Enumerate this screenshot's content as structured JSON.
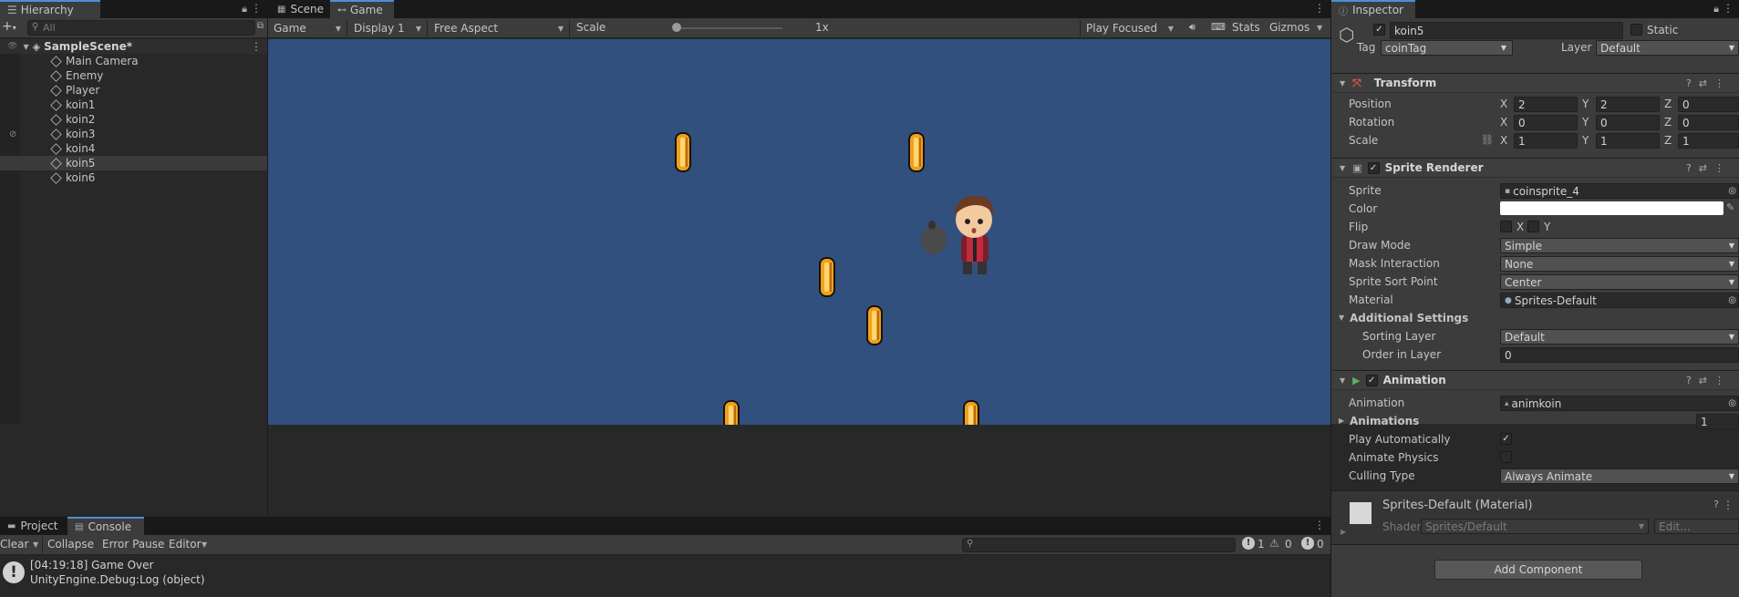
{
  "hierarchy": {
    "tab": "Hierarchy",
    "search_placeholder": "All",
    "scene": "SampleScene*",
    "items": [
      "Main Camera",
      "Enemy",
      "Player",
      "koin1",
      "koin2",
      "koin3",
      "koin4",
      "koin5",
      "koin6"
    ],
    "selected": "koin5"
  },
  "center_tabs": [
    "Scene",
    "Game"
  ],
  "game_toolbar": {
    "view": "Game",
    "display": "Display 1",
    "aspect": "Free Aspect",
    "scale_label": "Scale",
    "scale_value": "1x",
    "play_mode": "Play Focused",
    "stats": "Stats",
    "gizmos": "Gizmos"
  },
  "game_colors": {
    "background": "#31507e",
    "coin": "#f0a020"
  },
  "inspector": {
    "tab": "Inspector",
    "object_name": "koin5",
    "static_label": "Static",
    "tag_label": "Tag",
    "tag_value": "coinTag",
    "layer_label": "Layer",
    "layer_value": "Default",
    "transform": {
      "title": "Transform",
      "position_label": "Position",
      "position": [
        "2",
        "2",
        "0"
      ],
      "rotation_label": "Rotation",
      "rotation": [
        "0",
        "0",
        "0"
      ],
      "scale_label": "Scale",
      "scale": [
        "1",
        "1",
        "1"
      ],
      "axes": [
        "X",
        "Y",
        "Z"
      ]
    },
    "sprite_renderer": {
      "title": "Sprite Renderer",
      "sprite_label": "Sprite",
      "sprite": "coinsprite_4",
      "color_label": "Color",
      "flip_label": "Flip",
      "flip_x": "X",
      "flip_y": "Y",
      "draw_mode_label": "Draw Mode",
      "draw_mode": "Simple",
      "mask_label": "Mask Interaction",
      "mask": "None",
      "sort_point_label": "Sprite Sort Point",
      "sort_point": "Center",
      "material_label": "Material",
      "material": "Sprites-Default",
      "additional": "Additional Settings",
      "sorting_layer_label": "Sorting Layer",
      "sorting_layer": "Default",
      "order_label": "Order in Layer",
      "order": "0"
    },
    "animation": {
      "title": "Animation",
      "animation_label": "Animation",
      "animation": "animkoin",
      "animations_label": "Animations",
      "animations_count": "1",
      "play_auto_label": "Play Automatically",
      "animate_physics_label": "Animate Physics",
      "culling_label": "Culling Type",
      "culling": "Always Animate"
    },
    "material_section": {
      "title": "Sprites-Default (Material)",
      "shader_label": "Shader",
      "shader": "Sprites/Default",
      "edit": "Edit..."
    },
    "add_component": "Add Component"
  },
  "bottom": {
    "tabs": [
      "Project",
      "Console"
    ],
    "clear": "Clear",
    "collapse": "Collapse",
    "error_pause": "Error Pause",
    "editor": "Editor",
    "counts": [
      "1",
      "0",
      "0"
    ],
    "log_line1": "[04:19:18] Game Over",
    "log_line2": "UnityEngine.Debug:Log (object)"
  }
}
